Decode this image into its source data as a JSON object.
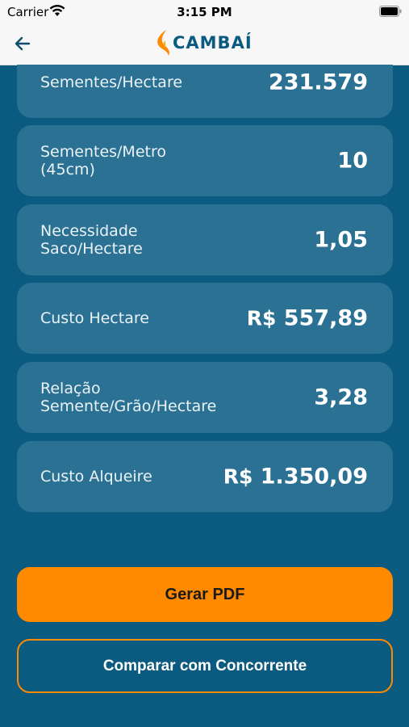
{
  "status_bar": {
    "carrier": "Carrier",
    "time": "3:15 PM"
  },
  "nav": {
    "brand": "CAMBAÍ"
  },
  "results": [
    {
      "label": "Sementes/Hectare",
      "value": "231.579"
    },
    {
      "label": "Sementes/Metro (45cm)",
      "value": "10"
    },
    {
      "label": "Necessidade Saco/Hectare",
      "value": "1,05"
    },
    {
      "label": "Custo Hectare",
      "currency": "R$",
      "value": "557,89"
    },
    {
      "label": "Relação Semente/Grão/Hectare",
      "value": "3,28"
    },
    {
      "label": "Custo Alqueire",
      "currency": "R$",
      "value": "1.350,09"
    }
  ],
  "actions": {
    "pdf_label": "Gerar PDF",
    "compare_label": "Comparar com Concorrente"
  },
  "colors": {
    "background": "#0b5a80",
    "card": "#2a7194",
    "accent": "#ff8a00"
  }
}
